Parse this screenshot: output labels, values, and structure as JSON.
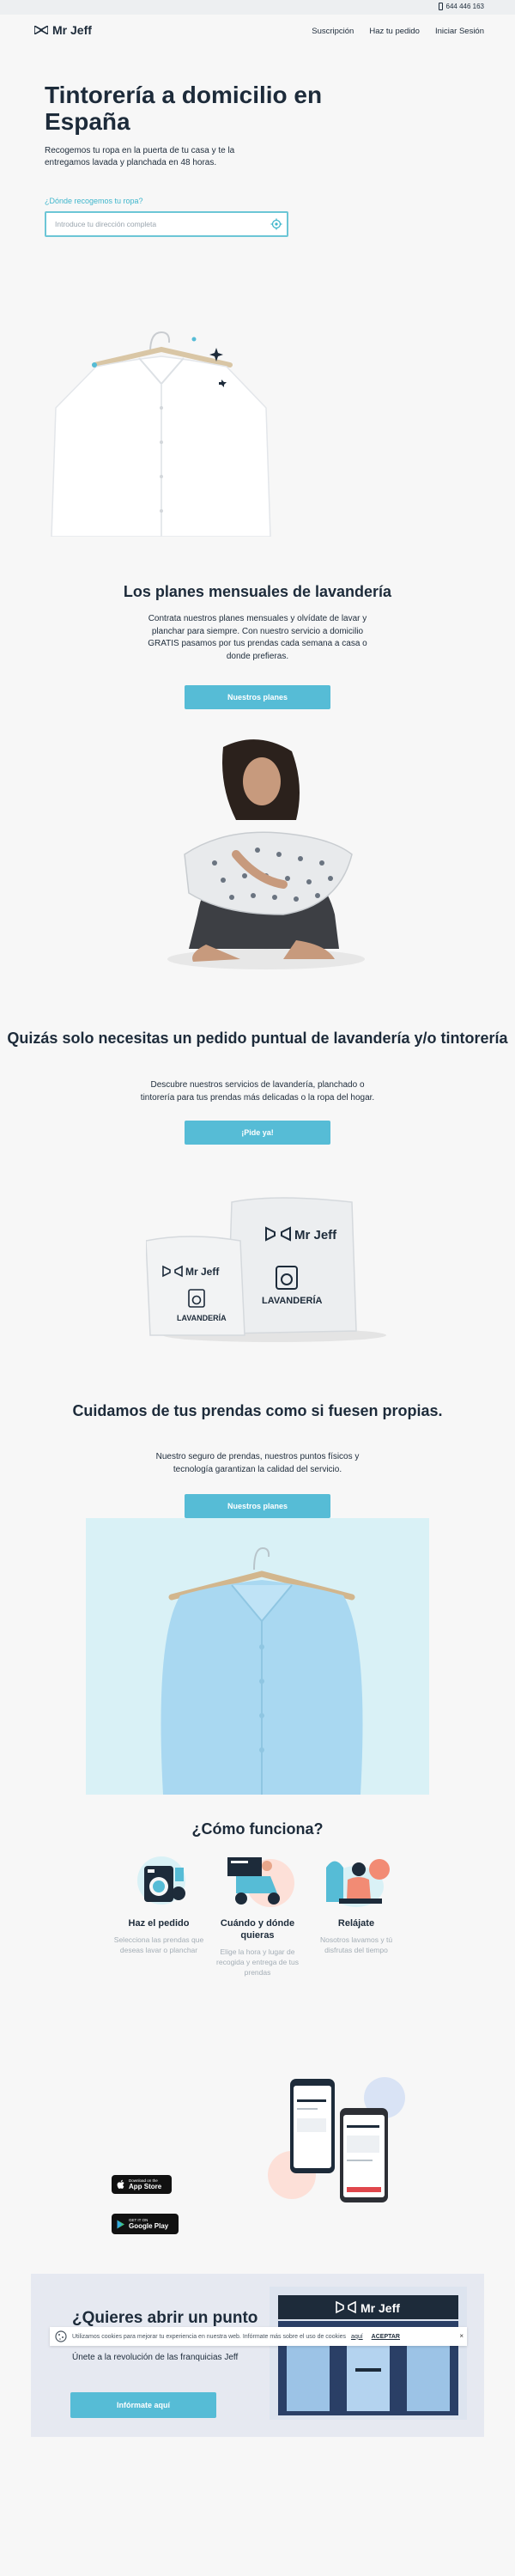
{
  "topbar": {
    "phone": "644 446 163",
    "phone_icon": "phone-icon"
  },
  "header": {
    "logo_text": "Mr Jeff",
    "logo_icon": "bowtie-icon",
    "nav": [
      "Suscripción",
      "Haz tu pedido",
      "Iniciar Sesión"
    ]
  },
  "hero": {
    "title": "Tintorería a domicilio en España",
    "subtitle": "Recogemos tu ropa en la puerta de tu casa y te la entregamos lavada y planchada en 48 horas.",
    "address_label": "¿Dónde recogemos tu ropa?",
    "address_placeholder": "Introduce tu dirección completa",
    "address_value": "",
    "locate_icon": "locate-icon"
  },
  "plans": {
    "title": "Los planes mensuales de lavandería",
    "text": "Contrata nuestros planes mensuales y olvídate de lavar y planchar para siempre. Con nuestro servicio a domicilio GRATIS pasamos por tus prendas cada semana a casa o donde prefieras.",
    "button": "Nuestros planes"
  },
  "single_order": {
    "title": "Quizás solo necesitas un pedido puntual de lavandería y/o tintorería",
    "text": "Descubre nuestros servicios de lavandería, planchado o tintorería para tus prendas más delicadas o la ropa del hogar.",
    "button": "¡Pide ya!"
  },
  "bags": {
    "brand": "Mr Jeff",
    "bag_label": "LAVANDERÍA"
  },
  "care": {
    "title": "Cuidamos de tus prendas como si fuesen propias.",
    "text": "Nuestro seguro de prendas, nuestros puntos físicos y tecnología garantizan la calidad del servicio.",
    "button": "Nuestros planes"
  },
  "how": {
    "title": "¿Cómo funciona?",
    "steps": [
      {
        "title": "Haz el pedido",
        "desc": "Selecciona las prendas que deseas lavar o planchar",
        "icon": "laundry-order-icon"
      },
      {
        "title": "Cuándo y dónde quieras",
        "desc": "Elige la hora y lugar de recogida y entrega de tus prendas",
        "icon": "delivery-scooter-icon"
      },
      {
        "title": "Relájate",
        "desc": "Nosotros lavamos y tú disfrutas del tiempo",
        "icon": "relax-icon"
      }
    ]
  },
  "stores": [
    {
      "small": "Download on the",
      "big": "App Store",
      "icon": "apple-icon"
    },
    {
      "small": "GET IT ON",
      "big": "Google Play",
      "icon": "play-icon"
    }
  ],
  "franchise": {
    "title": "¿Quieres abrir un punto Mr Jeff?",
    "subtitle": "Únete a la revolución de las franquicias Jeff",
    "button": "Infórmate aquí",
    "store_sign": "Mr Jeff"
  },
  "cookie": {
    "text": "Utilizamos cookies para mejorar tu experiencia en nuestra web. Infórmate más sobre el uso de cookies",
    "link": "aquí",
    "accept": "ACEPTAR",
    "close": "×",
    "icon": "cookie-icon"
  }
}
